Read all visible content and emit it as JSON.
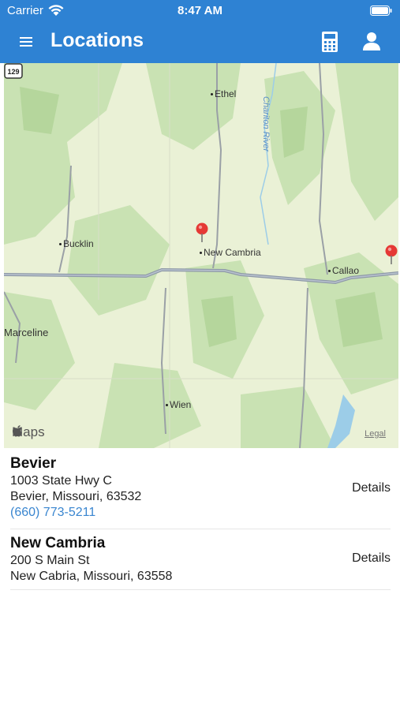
{
  "status_bar": {
    "carrier": "Carrier",
    "time": "8:47 AM"
  },
  "header": {
    "title": "Locations"
  },
  "map": {
    "places": {
      "ethel": "Ethel",
      "bucklin": "Bucklin",
      "new_cambria": "New Cambria",
      "callao": "Callao",
      "marceline": "Marceline",
      "wien": "Wien"
    },
    "river": "Chariton River",
    "route_shield": "129",
    "attribution": "Maps",
    "legal": "Legal"
  },
  "locations": [
    {
      "name": "Bevier",
      "street": "1003 State Hwy C",
      "city_line": "Bevier, Missouri, 63532",
      "phone": "(660) 773-5211",
      "details_label": "Details"
    },
    {
      "name": "New Cambria",
      "street": "200 S Main St",
      "city_line": "New Cabria, Missouri, 63558",
      "details_label": "Details"
    }
  ],
  "colors": {
    "header": "#2e82d3",
    "link": "#3a86d0",
    "pin": "#e53935"
  }
}
